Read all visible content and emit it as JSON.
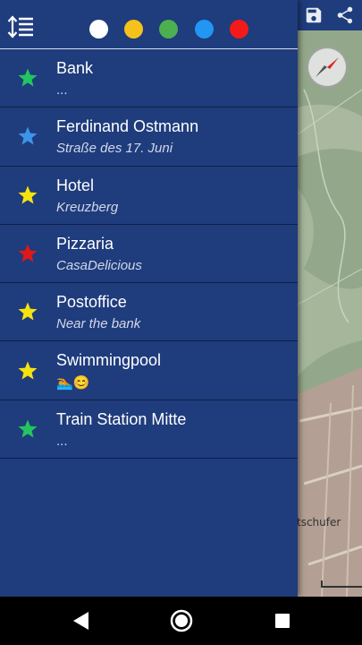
{
  "colors": {
    "drawer_bg": "#1f3c7d",
    "filter_white": "#ffffff",
    "filter_yellow": "#f4c21b",
    "filter_green": "#4caf50",
    "filter_blue": "#2196f3",
    "filter_red": "#f41a1a",
    "star_green": "#22c55e",
    "star_blue": "#3b95e8",
    "star_yellow": "#f5e30f",
    "star_red": "#e01818"
  },
  "header": {
    "sort_icon": "sort-icon",
    "filters": [
      {
        "name": "white",
        "color": "#ffffff"
      },
      {
        "name": "yellow",
        "color": "#f4c21b"
      },
      {
        "name": "green",
        "color": "#4caf50"
      },
      {
        "name": "blue",
        "color": "#2196f3"
      },
      {
        "name": "red",
        "color": "#f41a1a"
      }
    ]
  },
  "map": {
    "toolbar_icons": [
      "save-icon",
      "share-icon"
    ],
    "street_label": "tschufer"
  },
  "places": [
    {
      "title": "Bank",
      "subtitle": "...",
      "star": "green",
      "italic": false
    },
    {
      "title": "Ferdinand Ostmann",
      "subtitle": "Straße des 17. Juni",
      "star": "blue",
      "italic": true
    },
    {
      "title": "Hotel",
      "subtitle": "Kreuzberg",
      "star": "yellow",
      "italic": true
    },
    {
      "title": "Pizzaria",
      "subtitle": "CasaDelicious",
      "star": "red",
      "italic": true
    },
    {
      "title": "Postoffice",
      "subtitle": "Near the bank",
      "star": "yellow",
      "italic": true
    },
    {
      "title": "Swimmingpool",
      "subtitle": "🏊😊",
      "star": "yellow",
      "italic": false
    },
    {
      "title": "Train Station Mitte",
      "subtitle": "...",
      "star": "green",
      "italic": false
    }
  ],
  "navbar": {
    "buttons": [
      "back-icon",
      "home-icon",
      "recents-icon"
    ]
  }
}
